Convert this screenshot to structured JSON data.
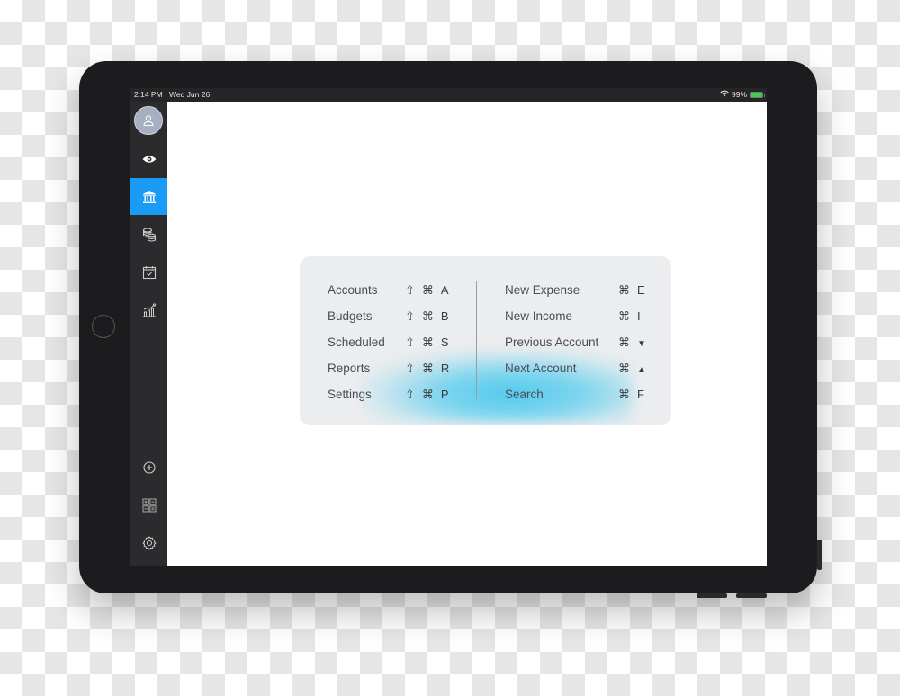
{
  "statusbar": {
    "time": "2:14 PM",
    "date": "Wed Jun 26",
    "battery_percent": "99%",
    "wifi_icon": "wifi-icon",
    "battery_icon": "battery-charging-icon"
  },
  "sidebar": {
    "avatar_icon": "user-icon",
    "items": [
      {
        "name": "overview",
        "icon": "eye-icon",
        "active": false
      },
      {
        "name": "accounts",
        "icon": "bank-icon",
        "active": true
      },
      {
        "name": "budgets",
        "icon": "coins-icon",
        "active": false
      },
      {
        "name": "scheduled",
        "icon": "calendar-check-icon",
        "active": false
      },
      {
        "name": "reports",
        "icon": "chart-icon",
        "active": false
      }
    ],
    "bottom_items": [
      {
        "name": "add",
        "icon": "plus-circle-icon"
      },
      {
        "name": "calculator",
        "icon": "calculator-icon"
      },
      {
        "name": "settings",
        "icon": "gear-icon"
      }
    ],
    "accent_color": "#1a9bf5"
  },
  "shortcuts": {
    "left": [
      {
        "label": "Accounts",
        "keys": [
          "⇧",
          "⌘",
          "A"
        ]
      },
      {
        "label": "Budgets",
        "keys": [
          "⇧",
          "⌘",
          "B"
        ]
      },
      {
        "label": "Scheduled",
        "keys": [
          "⇧",
          "⌘",
          "S"
        ]
      },
      {
        "label": "Reports",
        "keys": [
          "⇧",
          "⌘",
          "R"
        ]
      },
      {
        "label": "Settings",
        "keys": [
          "⇧",
          "⌘",
          "P"
        ]
      }
    ],
    "right": [
      {
        "label": "New Expense",
        "keys": [
          "⌘",
          "E"
        ]
      },
      {
        "label": "New Income",
        "keys": [
          "⌘",
          "I"
        ]
      },
      {
        "label": "Previous Account",
        "keys": [
          "⌘",
          "▼"
        ]
      },
      {
        "label": "Next Account",
        "keys": [
          "⌘",
          "▲"
        ]
      },
      {
        "label": "Search",
        "keys": [
          "⌘",
          "F"
        ]
      }
    ]
  }
}
